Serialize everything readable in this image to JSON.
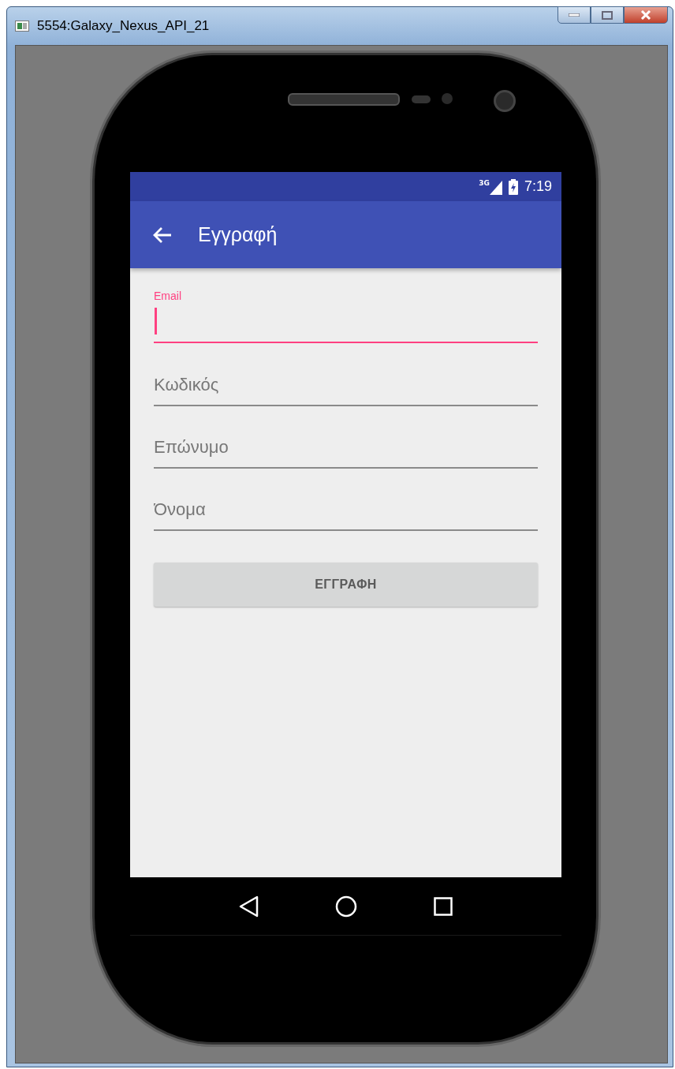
{
  "window": {
    "title": "5554:Galaxy_Nexus_API_21"
  },
  "status_bar": {
    "network": "3G",
    "time": "7:19"
  },
  "app_bar": {
    "title": "Εγγραφή"
  },
  "fields": [
    {
      "label": "Email",
      "focused": true
    },
    {
      "placeholder": "Κωδικός",
      "focused": false
    },
    {
      "placeholder": "Επώνυμο",
      "focused": false
    },
    {
      "placeholder": "Όνομα",
      "focused": false
    }
  ],
  "button": {
    "label": "ΕΓΓΡΑΦΗ"
  }
}
